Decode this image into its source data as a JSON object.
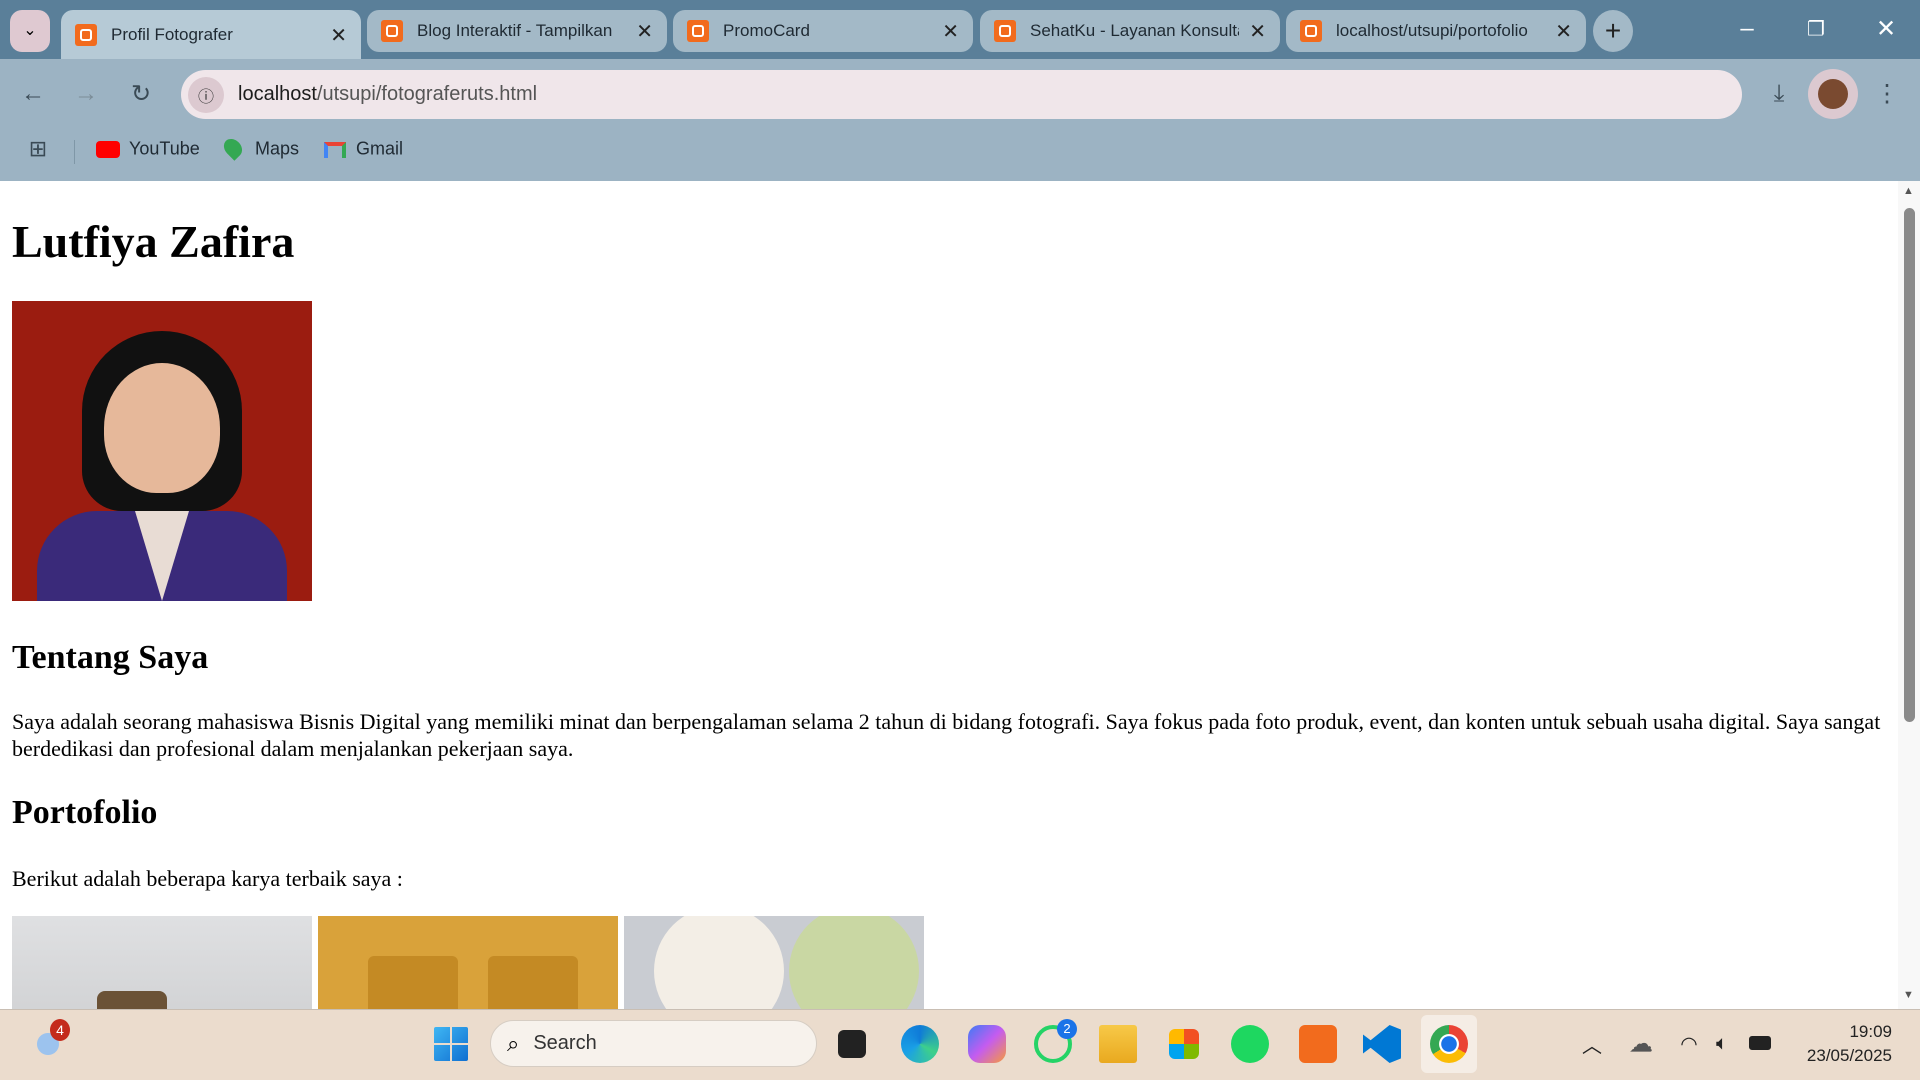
{
  "browser": {
    "tabs": [
      {
        "title": "Profil Fotografer",
        "active": true
      },
      {
        "title": "Blog Interaktif - Tampilkan"
      },
      {
        "title": "PromoCard"
      },
      {
        "title": "SehatKu - Layanan Konsultasi"
      },
      {
        "title": "localhost/utsupi/portofolio"
      }
    ],
    "url_host": "localhost",
    "url_path": "/utsupi/fotograferuts.html",
    "bookmarks": [
      {
        "label": "YouTube"
      },
      {
        "label": "Maps"
      },
      {
        "label": "Gmail"
      }
    ]
  },
  "page": {
    "name": "Lutfiya Zafira",
    "about_heading": "Tentang Saya",
    "about_text": "Saya adalah seorang mahasiswa Bisnis Digital yang memiliki minat dan berpengalaman selama 2 tahun di bidang fotografi. Saya fokus pada foto produk, event, dan konten untuk sebuah usaha digital. Saya sangat berdedikasi dan profesional dalam menjalankan pekerjaan saya.",
    "portfolio_heading": "Portofolio",
    "portfolio_intro": "Berikut adalah beberapa karya terbaik saya :"
  },
  "taskbar": {
    "weather_badge": "4",
    "search_placeholder": "Search",
    "whatsapp_badge": "2",
    "time": "19:09",
    "date": "23/05/2025"
  }
}
